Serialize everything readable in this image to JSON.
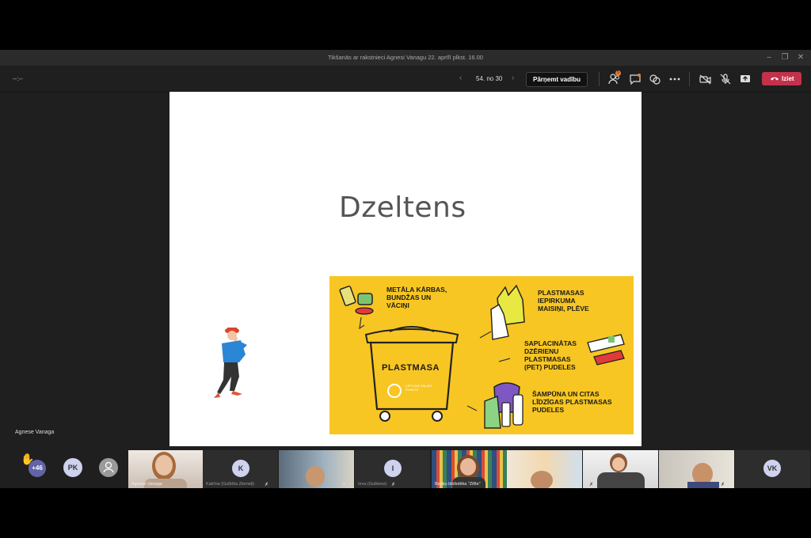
{
  "window": {
    "title": "Tikšanās ar rakstnieci Agnesi Vanagu 22. aprīlī plkst. 16.00"
  },
  "toolbar": {
    "timer": "--:--",
    "slide_counter": "54. no 30",
    "take_control_label": "Pārņemt vadību",
    "leave_label": "Iziet",
    "participants_badge": "5"
  },
  "slide": {
    "title": "Dzeltens",
    "bin_label": "PLASTMASA",
    "bin_small_text": "LATVIJAS ZAĻAIS PUNKTS",
    "captions": [
      [
        "METĀLA KĀRBAS,",
        "BUNDŽAS UN",
        "VĀCIŅI"
      ],
      [
        "PLASTMASAS",
        "IEPIRKUMA",
        "MAISIŅI, PLĒVE"
      ],
      [
        "SAPLACINĀTAS",
        "DZĒRIENU",
        "PLASTMASAS",
        "(PET) PUDELES"
      ],
      [
        "ŠAMPŪNA UN CITAS",
        "LĪDZĪGAS PLASTMASAS",
        "PUDELES"
      ]
    ]
  },
  "presenter": {
    "name": "Agnese Vanaga"
  },
  "strip": {
    "raised_more": "+46",
    "bubbles": [
      "PK"
    ],
    "tiles": [
      {
        "name": "Agnese Vanaga",
        "type": "video",
        "initials": ""
      },
      {
        "name": "Katrīna (Gulbīša Ziemeļi)",
        "type": "avatar",
        "initials": "K"
      },
      {
        "name": "",
        "type": "video",
        "initials": ""
      },
      {
        "name": "Ieva (Gulbene)",
        "type": "avatar",
        "initials": "I"
      },
      {
        "name": "Beņķu bibliotēka \"Zilīte\"",
        "type": "video",
        "initials": ""
      },
      {
        "name": "",
        "type": "video",
        "initials": ""
      },
      {
        "name": "",
        "type": "video",
        "initials": ""
      },
      {
        "name": "",
        "type": "video",
        "initials": ""
      },
      {
        "name": "",
        "type": "avatar",
        "initials": "VK"
      }
    ]
  },
  "colors": {
    "banner": "#f8c622",
    "leave": "#c4314b",
    "avatar": "#cfd2ee",
    "raise_hand": "#f5b700",
    "more_badge": "#6264a7"
  }
}
